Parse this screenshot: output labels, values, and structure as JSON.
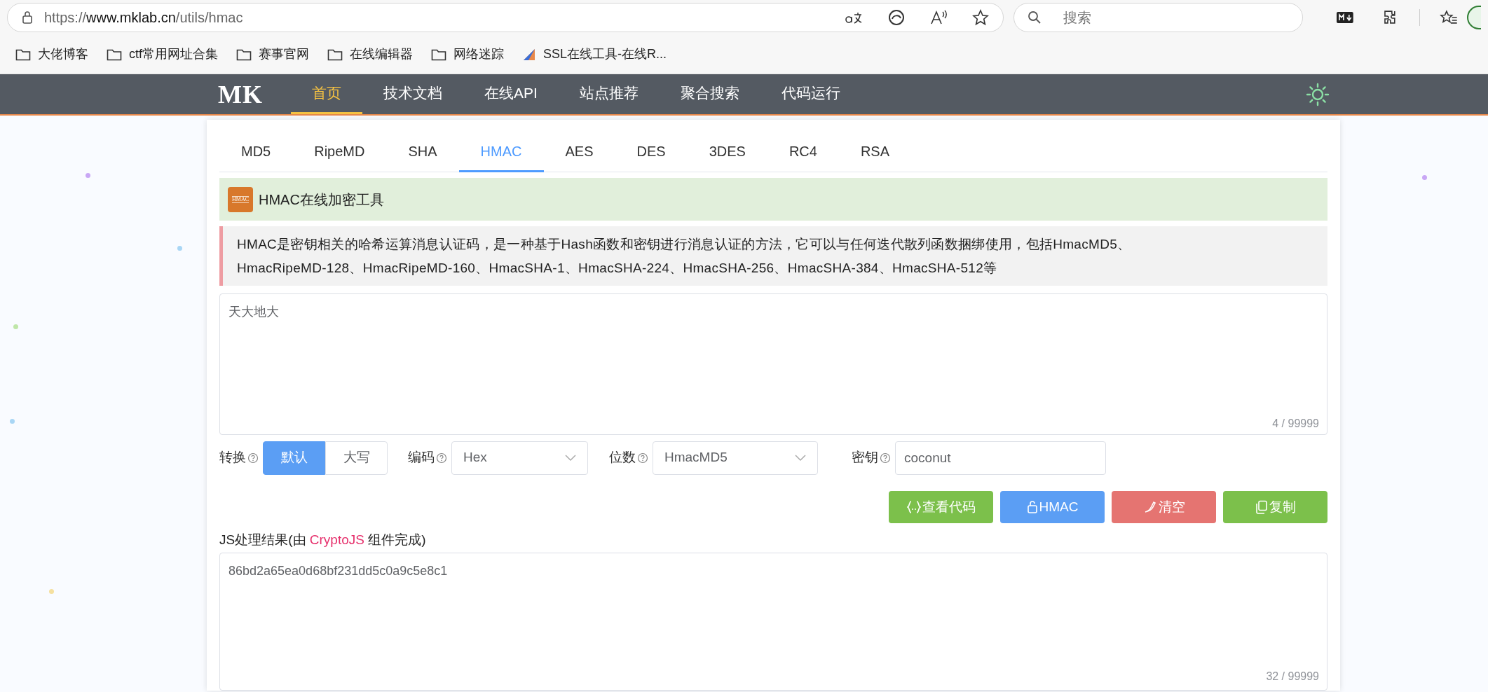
{
  "browser": {
    "url_prefix": "https://",
    "url_host": "www.mklab.cn",
    "url_path": "/utils/hmac",
    "search_placeholder": "搜索",
    "bookmarks": [
      {
        "label": "大佬博客",
        "kind": "folder"
      },
      {
        "label": "ctf常用网址合集",
        "kind": "folder"
      },
      {
        "label": "赛事官网",
        "kind": "folder"
      },
      {
        "label": "在线编辑器",
        "kind": "folder"
      },
      {
        "label": "网络迷踪",
        "kind": "folder"
      },
      {
        "label": "SSL在线工具-在线R...",
        "kind": "site"
      }
    ]
  },
  "nav": {
    "logo": "MK",
    "items": [
      {
        "label": "首页",
        "selected": true
      },
      {
        "label": "技术文档",
        "selected": false
      },
      {
        "label": "在线API",
        "selected": false
      },
      {
        "label": "站点推荐",
        "selected": false
      },
      {
        "label": "聚合搜索",
        "selected": false
      },
      {
        "label": "代码运行",
        "selected": false
      }
    ]
  },
  "tabs": [
    {
      "label": "MD5",
      "selected": false
    },
    {
      "label": "RipeMD",
      "selected": false
    },
    {
      "label": "SHA",
      "selected": false
    },
    {
      "label": "HMAC",
      "selected": true
    },
    {
      "label": "AES",
      "selected": false
    },
    {
      "label": "DES",
      "selected": false
    },
    {
      "label": "3DES",
      "selected": false
    },
    {
      "label": "RC4",
      "selected": false
    },
    {
      "label": "RSA",
      "selected": false
    }
  ],
  "header": {
    "icon_label": "HMAC",
    "title": "HMAC在线加密工具"
  },
  "description": "HMAC是密钥相关的哈希运算消息认证码，是一种基于Hash函数和密钥进行消息认证的方法，它可以与任何迭代散列函数捆绑使用，包括HmacMD5、HmacRipeMD-128、HmacRipeMD-160、HmacSHA-1、HmacSHA-224、HmacSHA-256、HmacSHA-384、HmacSHA-512等",
  "input": {
    "value": "天大地大",
    "counter": "4 / 99999"
  },
  "controls": {
    "convert": {
      "label": "转换",
      "options": [
        {
          "label": "默认",
          "selected": true
        },
        {
          "label": "大写",
          "selected": false
        }
      ]
    },
    "encoding": {
      "label": "编码",
      "value": "Hex"
    },
    "bits": {
      "label": "位数",
      "value": "HmacMD5"
    },
    "key": {
      "label": "密钥",
      "value": "coconut"
    }
  },
  "buttons": [
    {
      "label": "查看代码",
      "kind": "code",
      "color": "#7cc04b"
    },
    {
      "label": "HMAC",
      "kind": "lock",
      "color": "#5b9ef4"
    },
    {
      "label": "清空",
      "kind": "clear",
      "color": "#e57471"
    },
    {
      "label": "复制",
      "kind": "copy",
      "color": "#7cc04b"
    }
  ],
  "result_label": {
    "prefix": "JS处理结果(由 ",
    "link": "CryptoJS",
    "suffix": " 组件完成)"
  },
  "output": {
    "value": "86bd2a65ea0d68bf231dd5c0a9c5e8c1",
    "counter": "32 / 99999"
  }
}
